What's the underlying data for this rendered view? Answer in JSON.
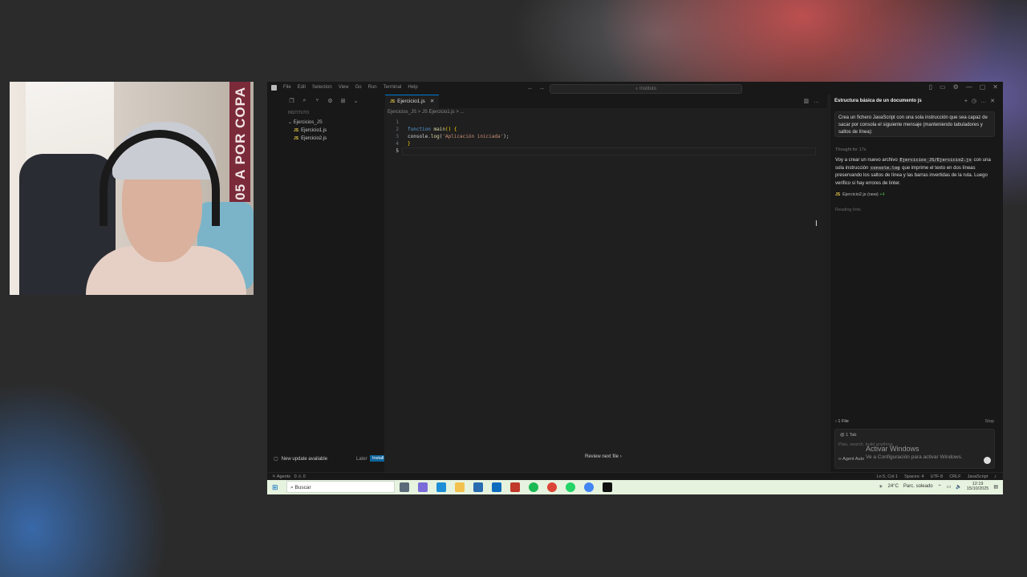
{
  "webcam": {
    "banner_text": "05 A POR COPA"
  },
  "titlebar": {
    "menu": [
      "File",
      "Edit",
      "Selection",
      "View",
      "Go",
      "Run",
      "Terminal",
      "Help"
    ],
    "search_placeholder": "Instituto"
  },
  "sidebar": {
    "header": "INSTITUTO",
    "folder": "Ejercicios_JS",
    "files": [
      "Ejercicio1.js",
      "Ejercicio2.js"
    ]
  },
  "update": {
    "text": "New update available",
    "later": "Later",
    "install": "Install Now"
  },
  "editor": {
    "tab": "Ejercicio1.js",
    "breadcrumb": "Ejercicios_JS > JS Ejercicio1.js > ...",
    "line_numbers": [
      "1",
      "2",
      "3",
      "4",
      "5"
    ],
    "review_next": "Review next file"
  },
  "chat": {
    "title": "Estructura básica de un documento js",
    "prompt": "Crea un fichero JavaScript con una sola instrucción que sea capaz de sacar por consola el siguiente mensaje (manteniendo tabuladores y saltos de línea):",
    "thought": "Thought for 17s",
    "msg_part1": "Voy a crear un nuevo archivo",
    "msg_code1": "Ejercicios_JS/Ejercicio2.js",
    "msg_part2": "con una sola instrucción",
    "msg_code2": "console.log",
    "msg_part3": "que imprime el texto en dos líneas preservando los saltos de línea y las barras invertidas de la ruta. Luego verifico si hay errores de linter.",
    "file_chip": "Ejercicio2.js",
    "file_new": "(new)",
    "file_add": "+4",
    "reading": "Reading lints",
    "files_count": "1 File",
    "stop": "Stop",
    "tab_chip": "1 Tab",
    "placeholder": "Plan, search, build anything",
    "agent": "Agent",
    "agent_mode": "Auto"
  },
  "activation": {
    "title": "Activar Windows",
    "subtitle": "Ve a Configuración para activar Windows."
  },
  "statusbar": {
    "agents": "Agents",
    "problems": "0 ⚠ 0",
    "cursor_pos": "Ln 5, Col 1",
    "spaces": "Spaces: 4",
    "encoding": "UTF-8",
    "eol": "CRLF",
    "language": "JavaScript"
  },
  "taskbar": {
    "search": "Buscar",
    "weather": "24°C",
    "weather_desc": "Parc. soleado",
    "time": "12:19",
    "date": "15/10/2025"
  },
  "colors": {
    "accent": "#0078d4",
    "taskbar": "#e6f3df",
    "editor_bg": "#1f1f1f"
  }
}
